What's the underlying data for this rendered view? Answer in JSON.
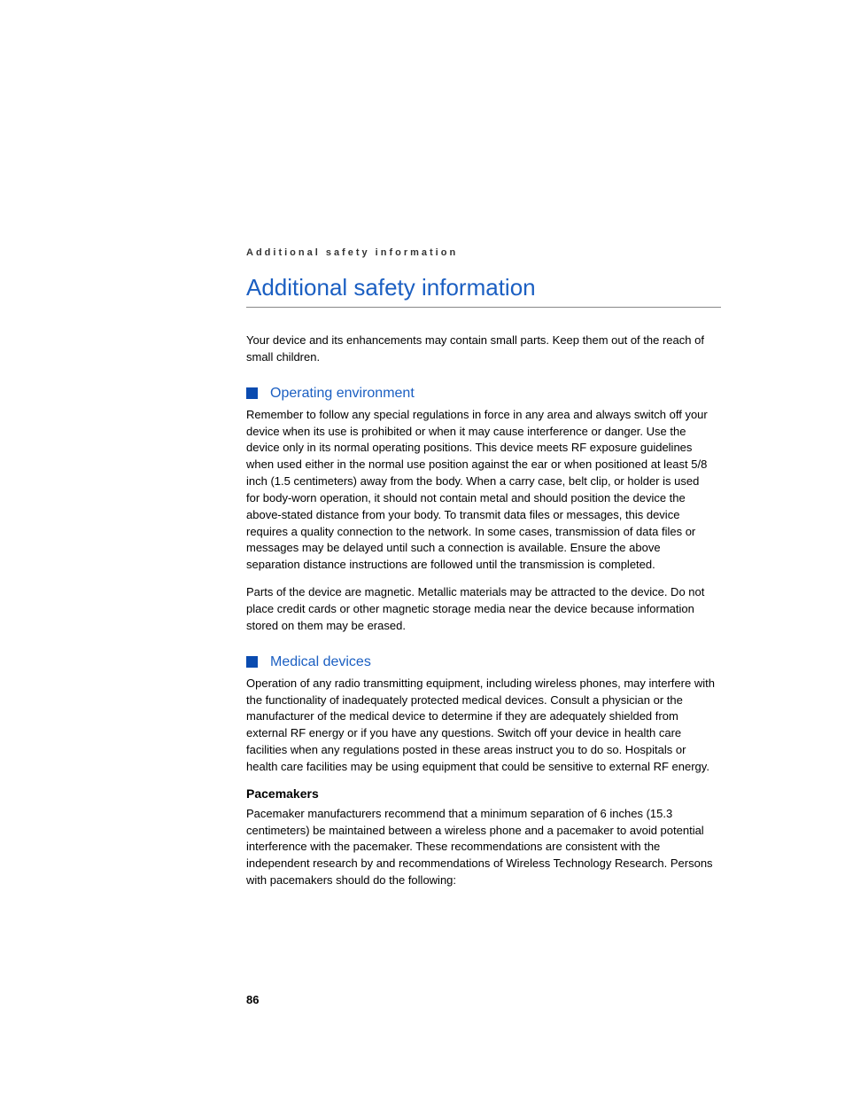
{
  "runningHeader": "Additional safety information",
  "mainTitle": "Additional safety information",
  "intro": "Your device and its enhancements may contain small parts. Keep them out of the reach of small children.",
  "section1": {
    "title": "Operating environment",
    "para1": "Remember to follow any special regulations in force in any area and always switch off your device when its use is prohibited or when it may cause interference or danger. Use the device only in its normal operating positions. This device meets RF exposure guidelines when used either in the normal use position against the ear or when positioned at least 5/8 inch (1.5 centimeters) away from the body. When a carry case, belt clip, or holder is used for body-worn operation, it should not contain metal and should position the device the above-stated distance from your body. To transmit data files or messages, this device requires a quality connection to the network. In some cases, transmission of data files or messages may be delayed until such a connection is available. Ensure the above separation distance instructions are followed until the transmission is completed.",
    "para2": "Parts of the device are magnetic. Metallic materials may be attracted to the device. Do not place credit cards or other magnetic storage media near the device because information stored on them may be erased."
  },
  "section2": {
    "title": "Medical devices",
    "para1": "Operation of any radio transmitting equipment, including wireless phones, may interfere with the functionality of inadequately protected medical devices. Consult a physician or the manufacturer of the medical device to determine if they are adequately shielded from external RF energy or if you have any questions. Switch off your device in health care facilities when any regulations posted in these areas instruct you to do so. Hospitals or health care facilities may be using equipment that could be sensitive to external RF energy.",
    "subHeading": "Pacemakers",
    "para2": "Pacemaker manufacturers recommend that a minimum separation of 6 inches (15.3 centimeters) be maintained between a wireless phone and a pacemaker to avoid potential interference with the pacemaker. These recommendations are consistent with the independent research by and recommendations of Wireless Technology Research. Persons with pacemakers should do the following:"
  },
  "pageNumber": "86"
}
